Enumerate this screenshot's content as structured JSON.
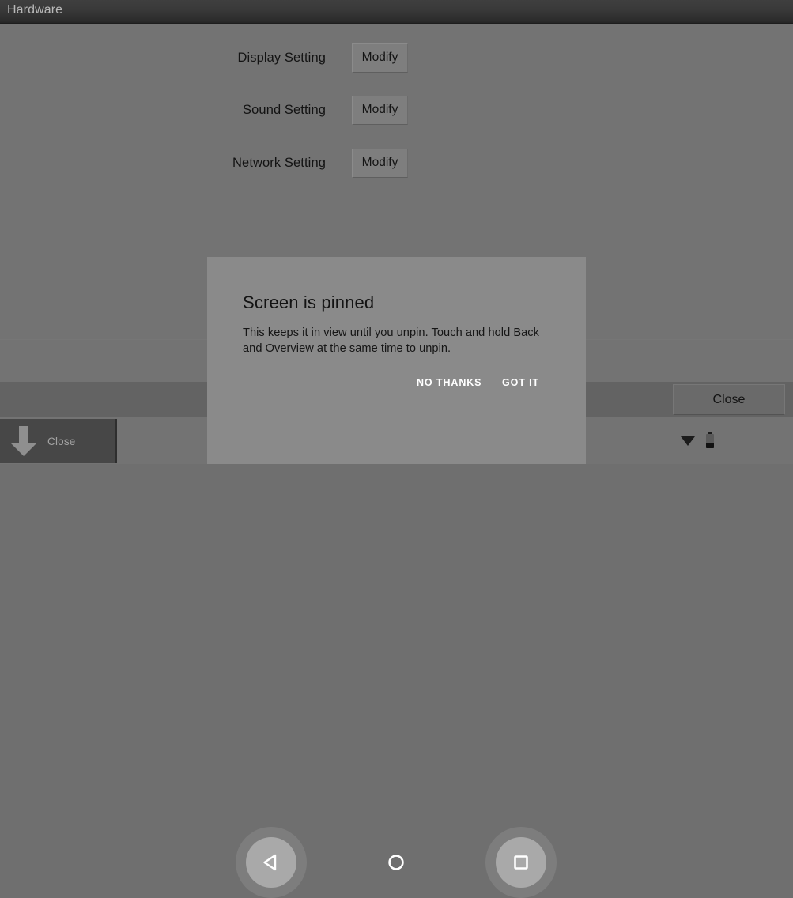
{
  "window": {
    "title": "Hardware"
  },
  "settings": {
    "rows": [
      {
        "label": "Display Setting",
        "button": "Modify"
      },
      {
        "label": "Sound Setting",
        "button": "Modify"
      },
      {
        "label": "Network Setting",
        "button": "Modify"
      }
    ]
  },
  "toolbar": {
    "close_label": "Close"
  },
  "close_panel": {
    "label": "Close",
    "icon": "arrow-down-icon"
  },
  "status_bar": {
    "wifi_icon": "wifi-icon",
    "battery_icon": "battery-icon"
  },
  "pin_dialog": {
    "title": "Screen is pinned",
    "body": "This keeps it in view until you unpin. Touch and hold Back and Overview at the same time to unpin.",
    "no_thanks_label": "NO THANKS",
    "got_it_label": "GOT IT"
  },
  "navbar": {
    "back_icon": "back-triangle-icon",
    "home_icon": "home-circle-icon",
    "recents_icon": "overview-square-icon"
  },
  "colors": {
    "background": "#737373",
    "titlebar": "#333333",
    "dialog": "#8a8a8a",
    "button": "#7e7e7e",
    "toolbar_strip": "#636363",
    "close_panel": "#474747",
    "text_dark": "#131313",
    "text_light": "#b9b9b9"
  }
}
